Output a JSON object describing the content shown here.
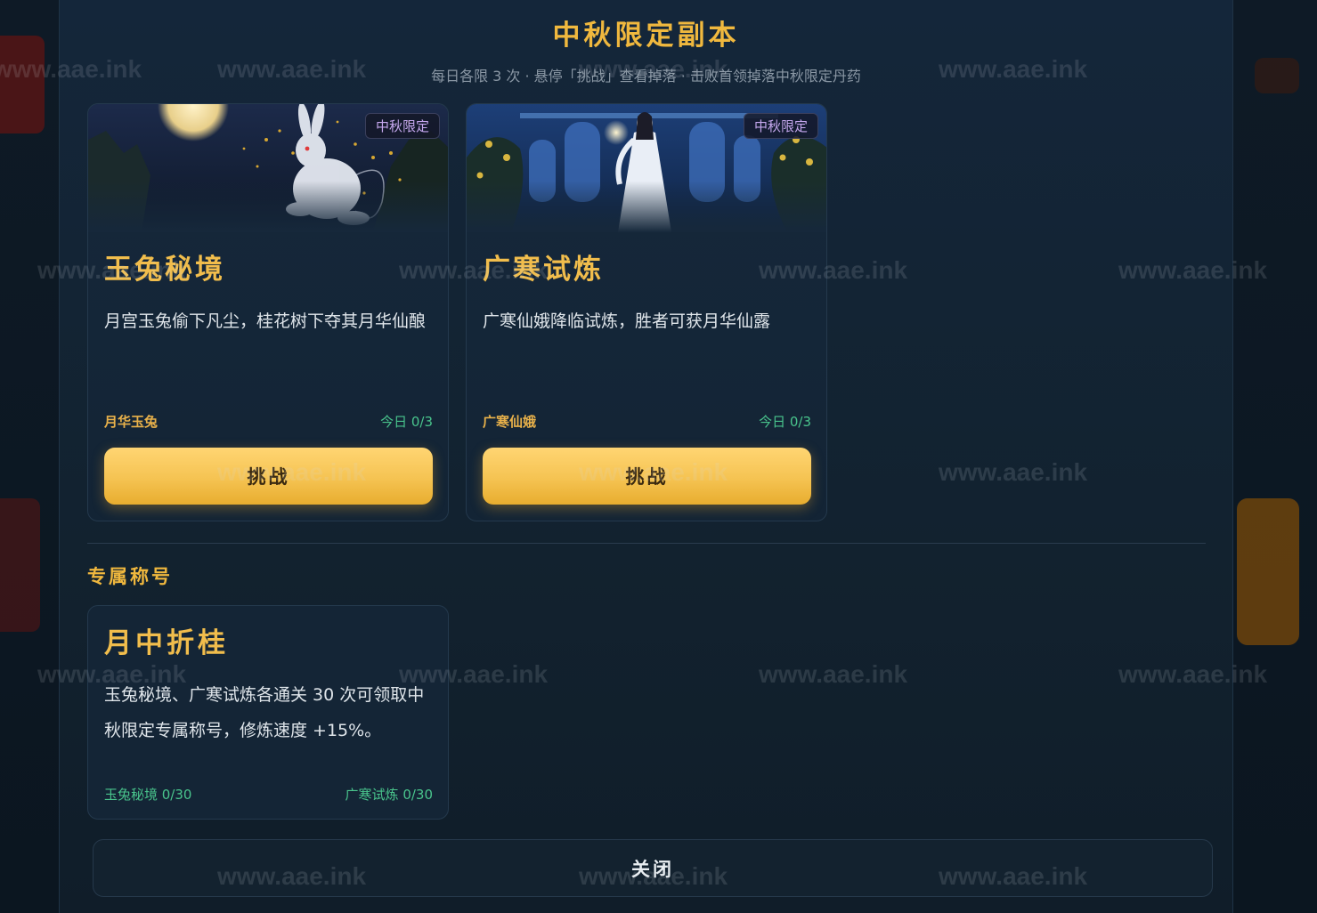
{
  "modal": {
    "title": "中秋限定副本",
    "subtitle": "每日各限 3 次 · 悬停「挑战」查看掉落 · 击败首领掉落中秋限定丹药"
  },
  "dungeons": [
    {
      "tag": "中秋限定",
      "name": "玉兔秘境",
      "description": "月宫玉兔偷下凡尘，桂花树下夺其月华仙酿",
      "boss": "月华玉兔",
      "today": "今日 0/3",
      "button": "挑战",
      "banner_icon": "moon-rabbit-illustration"
    },
    {
      "tag": "中秋限定",
      "name": "广寒试炼",
      "description": "广寒仙娥降临试炼，胜者可获月华仙露",
      "boss": "广寒仙娥",
      "today": "今日 0/3",
      "button": "挑战",
      "banner_icon": "moon-palace-fairy-illustration"
    }
  ],
  "title_section": {
    "heading": "专属称号",
    "name": "月中折桂",
    "description": "玉兔秘境、广寒试炼各通关 30 次可领取中秋限定专属称号，修炼速度 +15%。",
    "progress_rabbit": "玉兔秘境 0/30",
    "progress_guanghan": "广寒试炼 0/30"
  },
  "close_label": "关闭",
  "watermark": "www.aae.ink",
  "colors": {
    "gold": "#f0b83e",
    "green": "#49c48c",
    "purple_tag": "#c5a8ee",
    "panel": "#14263a"
  }
}
